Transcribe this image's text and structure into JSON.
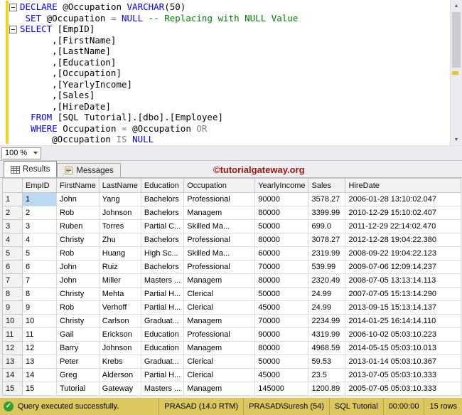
{
  "editor": {
    "zoom_label": "100 %",
    "lines": [
      {
        "fold": true,
        "tokens": [
          {
            "c": "kw",
            "t": "DECLARE"
          },
          {
            "c": "pl",
            "t": " @Occupation "
          },
          {
            "c": "kw",
            "t": "VARCHAR"
          },
          {
            "c": "pl",
            "t": "(50)"
          }
        ]
      },
      {
        "fold": false,
        "tokens": [
          {
            "c": "pl",
            "t": " "
          },
          {
            "c": "kw",
            "t": "SET"
          },
          {
            "c": "pl",
            "t": " @Occupation "
          },
          {
            "c": "op",
            "t": "="
          },
          {
            "c": "pl",
            "t": " "
          },
          {
            "c": "kw",
            "t": "NULL"
          },
          {
            "c": "pl",
            "t": " "
          },
          {
            "c": "cm",
            "t": "-- Replacing with NULL Value"
          }
        ]
      },
      {
        "fold": true,
        "tokens": [
          {
            "c": "kw",
            "t": "SELECT"
          },
          {
            "c": "pl",
            "t": " [EmpID]"
          }
        ]
      },
      {
        "fold": false,
        "tokens": [
          {
            "c": "pl",
            "t": "      ,[FirstName]"
          }
        ]
      },
      {
        "fold": false,
        "tokens": [
          {
            "c": "pl",
            "t": "      ,[LastName]"
          }
        ]
      },
      {
        "fold": false,
        "tokens": [
          {
            "c": "pl",
            "t": "      ,[Education]"
          }
        ]
      },
      {
        "fold": false,
        "tokens": [
          {
            "c": "pl",
            "t": "      ,[Occupation]"
          }
        ]
      },
      {
        "fold": false,
        "tokens": [
          {
            "c": "pl",
            "t": "      ,[YearlyIncome]"
          }
        ]
      },
      {
        "fold": false,
        "tokens": [
          {
            "c": "pl",
            "t": "      ,[Sales]"
          }
        ]
      },
      {
        "fold": false,
        "tokens": [
          {
            "c": "pl",
            "t": "      ,[HireDate]"
          }
        ]
      },
      {
        "fold": false,
        "tokens": [
          {
            "c": "pl",
            "t": "  "
          },
          {
            "c": "kw",
            "t": "FROM"
          },
          {
            "c": "pl",
            "t": " [SQL Tutorial].[dbo].[Employee]"
          }
        ]
      },
      {
        "fold": false,
        "tokens": [
          {
            "c": "pl",
            "t": "  "
          },
          {
            "c": "kw",
            "t": "WHERE"
          },
          {
            "c": "pl",
            "t": " Occupation "
          },
          {
            "c": "op",
            "t": "="
          },
          {
            "c": "pl",
            "t": " @Occupation "
          },
          {
            "c": "op",
            "t": "OR"
          }
        ]
      },
      {
        "fold": false,
        "tokens": [
          {
            "c": "pl",
            "t": "      @Occupation "
          },
          {
            "c": "op",
            "t": "IS"
          },
          {
            "c": "pl",
            "t": " "
          },
          {
            "c": "kw",
            "t": "NULL"
          }
        ]
      }
    ]
  },
  "tabs": {
    "results": "Results",
    "messages": "Messages"
  },
  "watermark": "©tutorialgateway.org",
  "grid": {
    "columns": [
      "",
      "EmpID",
      "FirstName",
      "LastName",
      "Education",
      "Occupation",
      "YearlyIncome",
      "Sales",
      "HireDate"
    ],
    "rows": [
      [
        "1",
        "1",
        "John",
        "Yang",
        "Bachelors",
        "Professional",
        "90000",
        "3578.27",
        "2006-01-28 13:10:02.047"
      ],
      [
        "2",
        "2",
        "Rob",
        "Johnson",
        "Bachelors",
        "Managem",
        "80000",
        "3399.99",
        "2010-12-29 15:10:02.407"
      ],
      [
        "3",
        "3",
        "Ruben",
        "Torres",
        "Partial C...",
        "Skilled Ma...",
        "50000",
        "699.0",
        "2011-12-29 22:14:02.470"
      ],
      [
        "4",
        "4",
        "Christy",
        "Zhu",
        "Bachelors",
        "Professional",
        "80000",
        "3078.27",
        "2012-12-28 19:04:22.380"
      ],
      [
        "5",
        "5",
        "Rob",
        "Huang",
        "High Sc...",
        "Skilled Ma...",
        "60000",
        "2319.99",
        "2008-09-22 19:04:22.123"
      ],
      [
        "6",
        "6",
        "John",
        "Ruiz",
        "Bachelors",
        "Professional",
        "70000",
        "539.99",
        "2009-07-06 12:09:14.237"
      ],
      [
        "7",
        "7",
        "John",
        "Miller",
        "Masters ...",
        "Managem",
        "80000",
        "2320.49",
        "2008-07-05 13:13:14.113"
      ],
      [
        "8",
        "8",
        "Christy",
        "Mehta",
        "Partial H...",
        "Clerical",
        "50000",
        "24.99",
        "2007-07-05 15:13:14.290"
      ],
      [
        "9",
        "9",
        "Rob",
        "Verhoff",
        "Partial H...",
        "Clerical",
        "45000",
        "24.99",
        "2013-09-15 15:13:14.137"
      ],
      [
        "10",
        "10",
        "Christy",
        "Carlson",
        "Graduat...",
        "Managem",
        "70000",
        "2234.99",
        "2014-01-25 16:14:14.110"
      ],
      [
        "11",
        "11",
        "Gail",
        "Erickson",
        "Education",
        "Professional",
        "90000",
        "4319.99",
        "2006-10-02 05:03:10.223"
      ],
      [
        "12",
        "12",
        "Barry",
        "Johnson",
        "Education",
        "Managem",
        "80000",
        "4968.59",
        "2014-05-15 05:03:10.013"
      ],
      [
        "13",
        "13",
        "Peter",
        "Krebs",
        "Graduat...",
        "Clerical",
        "50000",
        "59.53",
        "2013-01-14 05:03:10.367"
      ],
      [
        "14",
        "14",
        "Greg",
        "Alderson",
        "Partial H...",
        "Clerical",
        "45000",
        "23.5",
        "2013-07-05 05:03:10.333"
      ],
      [
        "15",
        "15",
        "Tutorial",
        "Gateway",
        "Masters ...",
        "Managem",
        "145000",
        "1200.89",
        "2005-07-05 05:03:10.333"
      ]
    ],
    "selected_cell": {
      "row_index": 0,
      "col_index": 1
    }
  },
  "status": {
    "message": "Query executed successfully.",
    "segments": [
      "PRASAD (14.0 RTM)",
      "PRASAD\\Suresh (54)",
      "SQL Tutorial",
      "00:00:00",
      "15 rows"
    ]
  },
  "colors": {
    "keyword_blue": "#0000FF",
    "comment_green": "#008000",
    "operator_gray": "#7F7F7F",
    "watermark_red": "#9C150F",
    "statusbar_gold": "#DCC75F",
    "success_green": "#2FA12F",
    "selection_blue": "#BCD8F2",
    "change_bar_yellow": "#F2D41C"
  }
}
